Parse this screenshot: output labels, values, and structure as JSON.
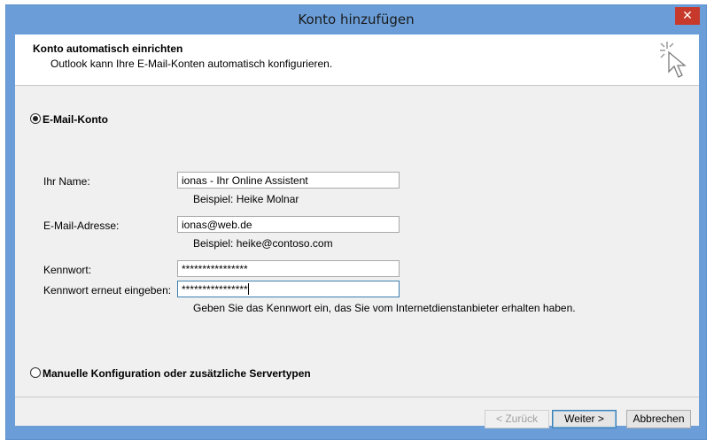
{
  "window": {
    "title": "Konto hinzufügen",
    "close_glyph": "✕"
  },
  "header": {
    "title": "Konto automatisch einrichten",
    "subtitle": "Outlook kann Ihre E-Mail-Konten automatisch konfigurieren.",
    "icon": "cursor-sparkle-icon"
  },
  "options": {
    "email_account_label": "E-Mail-Konto",
    "manual_label": "Manuelle Konfiguration oder zusätzliche Servertypen",
    "selected": "email_account"
  },
  "form": {
    "name_label": "Ihr Name:",
    "name_value": "ionas - Ihr Online Assistent",
    "name_hint": "Beispiel: Heike Molnar",
    "email_label": "E-Mail-Adresse:",
    "email_value": "ionas@web.de",
    "email_hint": "Beispiel: heike@contoso.com",
    "password_label": "Kennwort:",
    "password_value": "****************",
    "password_confirm_label": "Kennwort erneut eingeben:",
    "password_confirm_value": "****************",
    "password_hint": "Geben Sie das Kennwort ein, das Sie vom Internetdienstanbieter erhalten haben."
  },
  "buttons": {
    "back": "< Zurück",
    "next": "Weiter >",
    "cancel": "Abbrechen"
  }
}
